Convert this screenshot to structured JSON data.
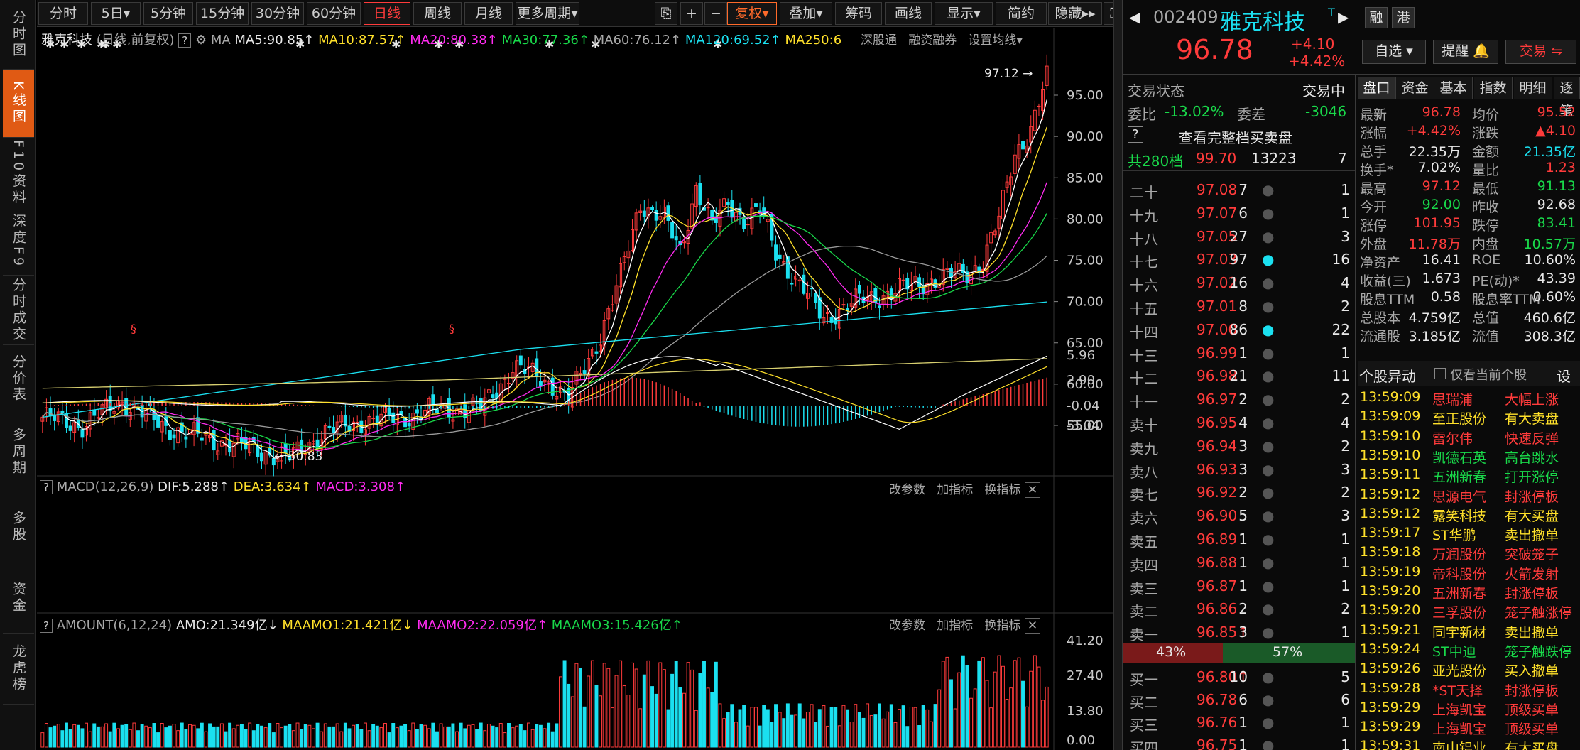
{
  "leftnav": [
    "分时图",
    "K线图",
    "F10资料",
    "深度F9",
    "分时成交",
    "分价表",
    "多周期",
    "多股",
    "资金",
    "龙虎榜"
  ],
  "toolbar": {
    "periods": [
      "分时",
      "5日",
      "5分钟",
      "15分钟",
      "30分钟",
      "60分钟",
      "日线",
      "周线",
      "月线",
      "更多周期"
    ],
    "tools": [
      "复权",
      "叠加",
      "筹码",
      "画线",
      "显示",
      "简约",
      "隐藏"
    ]
  },
  "kline": {
    "title": "雅克科技",
    "subtitle": "(日线,前复权)",
    "ma_label": "MA",
    "ma": [
      "MA5:90.85",
      "MA10:87.57",
      "MA20:80.38",
      "MA30:77.36",
      "MA60:76.12",
      "MA120:69.52",
      "MA250:6"
    ],
    "links": [
      "深股通",
      "融资融券",
      "设置均线"
    ],
    "high_mark": "97.12",
    "low_mark": "50.83",
    "yticks": [
      "95.00",
      "90.00",
      "85.00",
      "80.00",
      "75.00",
      "70.00",
      "65.00",
      "60.00",
      "55.00"
    ]
  },
  "macd": {
    "title": "MACD(12,26,9)",
    "dif": "DIF:5.288",
    "dea": "DEA:3.634",
    "macd": "MACD:3.308",
    "buttons": [
      "改参数",
      "加指标",
      "换指标"
    ],
    "yticks": [
      "5.96",
      "2.90",
      "-0.04",
      "-3.04"
    ]
  },
  "amount": {
    "title": "AMOUNT(6,12,24)",
    "amo": "AMO:21.349亿",
    "m1": "MAAMO1:21.421亿",
    "m2": "MAAMO2:22.059亿",
    "m3": "MAAMO3:15.426亿",
    "buttons": [
      "改参数",
      "加指标",
      "换指标"
    ],
    "yticks": [
      "41.20",
      "27.40",
      "13.80",
      "0.00"
    ]
  },
  "stock": {
    "code": "002409",
    "name": "雅克科技",
    "price": "96.78",
    "chg": "+4.10",
    "pct": "+4.42%",
    "badges": [
      "融",
      "港"
    ],
    "buttons": [
      "自选",
      "提醒",
      "交易"
    ]
  },
  "orderbook": {
    "state_label": "交易状态",
    "state": "交易中",
    "weibi_label": "委比",
    "weibi": "-13.02%",
    "weicha_label": "委差",
    "weicha": "-3046",
    "full_btn": "查看完整档买卖盘",
    "levels_label": "共280档",
    "levels_price": "99.70",
    "levels_vol": "13223",
    "levels_n": "7",
    "asks": [
      [
        "二十",
        "97.08",
        "7",
        "1"
      ],
      [
        "十九",
        "97.07",
        "6",
        "1"
      ],
      [
        "十八",
        "97.05",
        "27",
        "3"
      ],
      [
        "十七",
        "97.03",
        "97",
        "16"
      ],
      [
        "十六",
        "97.02",
        "16",
        "4"
      ],
      [
        "十五",
        "97.01",
        "8",
        "2"
      ],
      [
        "十四",
        "97.00",
        "86",
        "22"
      ],
      [
        "十三",
        "96.99",
        "1",
        "1"
      ],
      [
        "十二",
        "96.98",
        "21",
        "11"
      ],
      [
        "十一",
        "96.97",
        "2",
        "2"
      ],
      [
        "卖十",
        "96.95",
        "4",
        "4"
      ],
      [
        "卖九",
        "96.94",
        "3",
        "2"
      ],
      [
        "卖八",
        "96.93",
        "3",
        "3"
      ],
      [
        "卖七",
        "96.92",
        "2",
        "2"
      ],
      [
        "卖六",
        "96.90",
        "5",
        "3"
      ],
      [
        "卖五",
        "96.89",
        "1",
        "1"
      ],
      [
        "卖四",
        "96.88",
        "1",
        "1"
      ],
      [
        "卖三",
        "96.87",
        "1",
        "1"
      ],
      [
        "卖二",
        "96.86",
        "2",
        "2"
      ],
      [
        "卖一",
        "96.85",
        "3",
        "1"
      ]
    ],
    "ratio": [
      "43%",
      "57%"
    ],
    "bids": [
      [
        "买一",
        "96.80",
        "10",
        "5"
      ],
      [
        "买二",
        "96.78",
        "6",
        "6"
      ],
      [
        "买三",
        "96.76",
        "1",
        "1"
      ],
      [
        "买四",
        "96.75",
        "1",
        "1"
      ]
    ]
  },
  "tabs": [
    "盘口",
    "资金",
    "基本",
    "指数",
    "明细",
    "逐笔"
  ],
  "stats": [
    [
      "最新",
      "96.78",
      "均价",
      "95.52"
    ],
    [
      "涨幅",
      "+4.42%",
      "涨跌",
      "▲4.10"
    ],
    [
      "总手",
      "22.35万",
      "金额",
      "21.35亿"
    ],
    [
      "换手*",
      "7.02%",
      "量比",
      "1.23"
    ],
    [
      "最高",
      "97.12",
      "最低",
      "91.13"
    ],
    [
      "今开",
      "92.00",
      "昨收",
      "92.68"
    ],
    [
      "涨停",
      "101.95",
      "跌停",
      "83.41"
    ],
    [
      "外盘",
      "11.78万",
      "内盘",
      "10.57万"
    ],
    [
      "净资产",
      "16.41",
      "ROE",
      "10.60%"
    ],
    [
      "收益(三)",
      "1.673",
      "PE(动)*",
      "43.39"
    ],
    [
      "股息TTM",
      "0.58",
      "股息率TTM",
      "0.60%"
    ],
    [
      "总股本",
      "4.759亿",
      "总值",
      "460.6亿"
    ],
    [
      "流通股",
      "3.185亿",
      "流值",
      "308.3亿"
    ]
  ],
  "events_title": "个股异动",
  "events_only": "仅看当前个股",
  "events_set": "设",
  "events": [
    [
      "13:59:09",
      "思瑞浦",
      "大幅上涨",
      "r"
    ],
    [
      "13:59:09",
      "至正股份",
      "有大卖盘",
      "y"
    ],
    [
      "13:59:10",
      "雷尔伟",
      "快速反弹",
      "r"
    ],
    [
      "13:59:10",
      "凯德石英",
      "高台跳水",
      "g"
    ],
    [
      "13:59:11",
      "五洲新春",
      "打开涨停",
      "g"
    ],
    [
      "13:59:12",
      "思源电气",
      "封涨停板",
      "r"
    ],
    [
      "13:59:12",
      "露笑科技",
      "有大买盘",
      "y"
    ],
    [
      "13:59:17",
      "ST华鹏",
      "卖出撤单",
      "y"
    ],
    [
      "13:59:18",
      "万润股份",
      "突破笼子",
      "r"
    ],
    [
      "13:59:19",
      "帝科股份",
      "火箭发射",
      "r"
    ],
    [
      "13:59:20",
      "五洲新春",
      "封涨停板",
      "r"
    ],
    [
      "13:59:20",
      "三孚股份",
      "笼子触涨停",
      "r"
    ],
    [
      "13:59:21",
      "同宇新材",
      "卖出撤单",
      "y"
    ],
    [
      "13:59:24",
      "ST中迪",
      "笼子触跌停",
      "g"
    ],
    [
      "13:59:26",
      "亚光股份",
      "买入撤单",
      "y"
    ],
    [
      "13:59:28",
      "*ST天择",
      "封涨停板",
      "r"
    ],
    [
      "13:59:29",
      "上海凯宝",
      "顶级买单",
      "r"
    ],
    [
      "13:59:29",
      "上海凯宝",
      "顶级买单",
      "r"
    ],
    [
      "13:59:31",
      "南山铝业",
      "有大买盘",
      "y"
    ]
  ]
}
